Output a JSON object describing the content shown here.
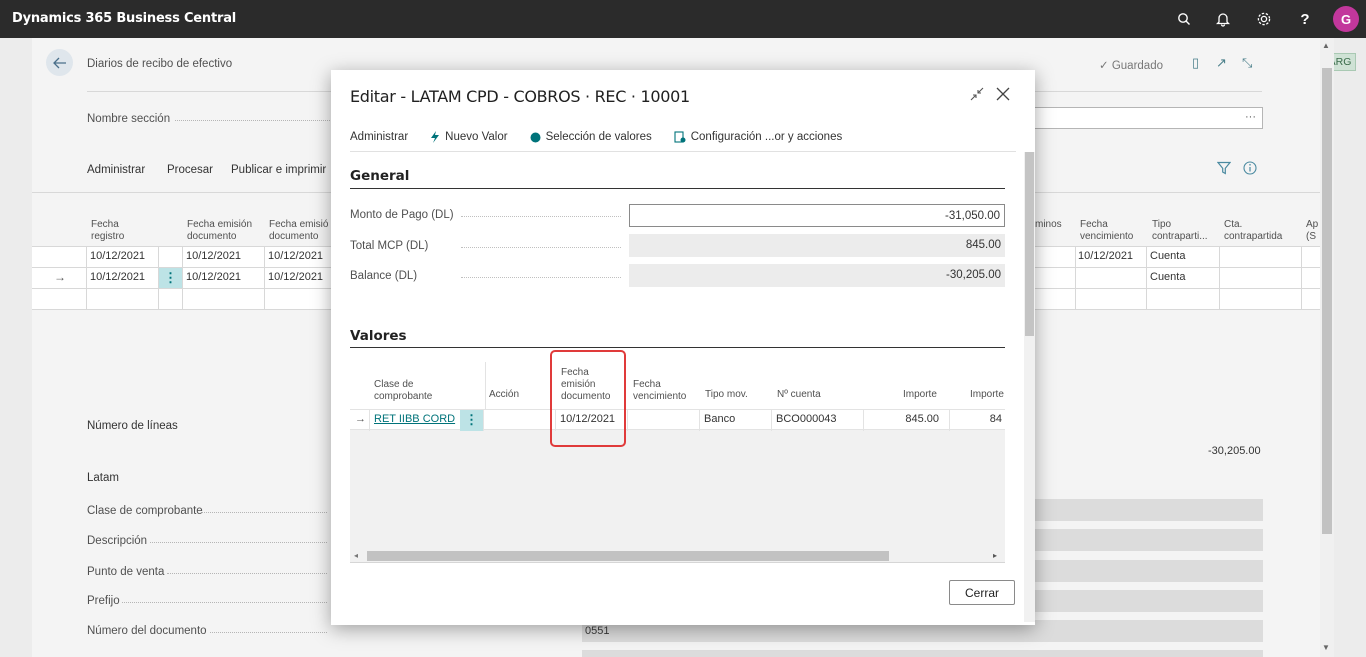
{
  "topbar": {
    "app_title": "Dynamics 365 Business Central",
    "avatar_initial": "G",
    "icons": [
      "search-icon",
      "bell-icon",
      "gear-icon",
      "help-icon"
    ]
  },
  "background": {
    "page_title": "Diarios de recibo de efectivo",
    "saved_status": "Guardado",
    "section_name_label": "Nombre sección",
    "section_name_ellipsis": "···",
    "actions": [
      "Administrar",
      "Procesar",
      "Publicar e imprimir"
    ],
    "locale_badge": "ARG",
    "columns": [
      {
        "l1": "Fecha",
        "l2": "registro"
      },
      {
        "l1": "Fecha emisión",
        "l2": "documento"
      },
      {
        "l1": "Fecha emisión",
        "l2": "documento"
      },
      {
        "l1": "minos",
        "l2": ""
      },
      {
        "l1": "Fecha",
        "l2": "vencimiento"
      },
      {
        "l1": "Tipo",
        "l2": "contraparti..."
      },
      {
        "l1": "Cta.",
        "l2": "contrapartida"
      },
      {
        "l1": "Ap",
        "l2": "(S"
      }
    ],
    "rows": [
      {
        "c1": "10/12/2021",
        "c2": "10/12/2021",
        "c3": "10/12/2021",
        "c4": "10/12/2021",
        "c5": "Cuenta"
      },
      {
        "c1": "10/12/2021",
        "c2": "10/12/2021",
        "c3": "10/12/2021",
        "c4": "",
        "c5": "Cuenta"
      }
    ],
    "line_count_label": "Número de líneas",
    "balance_value": "-30,205.00",
    "latam_label": "Latam",
    "fields": [
      "Clase de comprobante",
      "Descripción",
      "Punto de venta",
      "Prefijo",
      "Número del documento"
    ],
    "doc_number_value": "0551"
  },
  "dialog": {
    "title": "Editar - LATAM CPD - COBROS · REC · 10001",
    "menu": {
      "administrar": "Administrar",
      "nuevo_valor": "Nuevo Valor",
      "seleccion": "Selección de valores",
      "configuracion": "Configuración ...or y acciones"
    },
    "general": {
      "title": "General",
      "monto_label": "Monto de Pago (DL)",
      "monto_value": "-31,050.00",
      "total_label": "Total MCP (DL)",
      "total_value": "845.00",
      "balance_label": "Balance (DL)",
      "balance_value": "-30,205.00"
    },
    "valores": {
      "title": "Valores",
      "headers": {
        "clase_l1": "Clase de",
        "clase_l2": "comprobante",
        "accion": "Acción",
        "fecha_emision_l1": "Fecha",
        "fecha_emision_l2": "emisión",
        "fecha_emision_l3": "documento",
        "fecha_venc_l1": "Fecha",
        "fecha_venc_l2": "vencimiento",
        "tipo_mov": "Tipo mov.",
        "nro_cuenta": "Nº cuenta",
        "importe": "Importe",
        "importe2": "Importe"
      },
      "row": {
        "clase": "RET IIBB CORD",
        "accion": "",
        "fecha_emision": "10/12/2021",
        "fecha_venc": "",
        "tipo_mov": "Banco",
        "nro_cuenta": "BCO000043",
        "importe": "845.00",
        "importe2": "84"
      }
    },
    "close_button": "Cerrar"
  }
}
